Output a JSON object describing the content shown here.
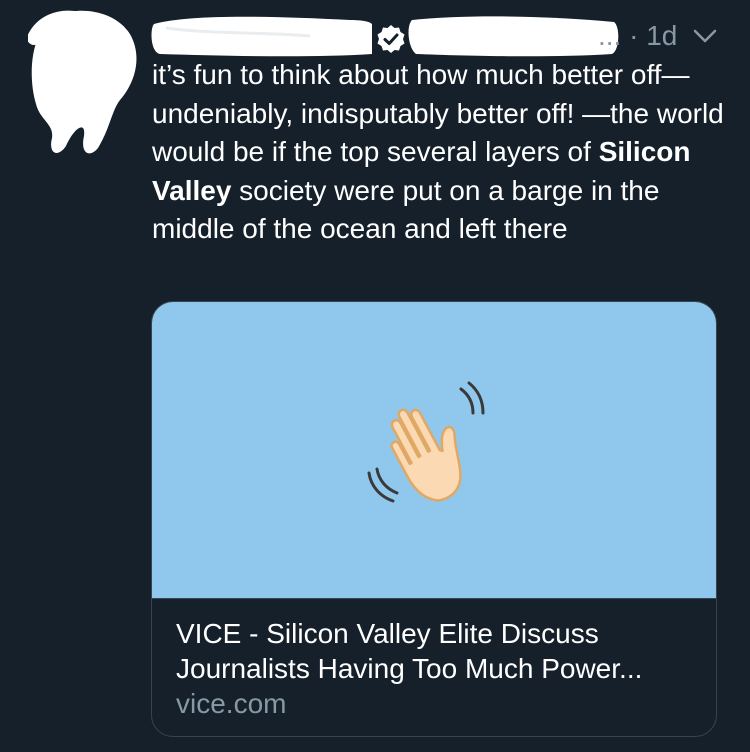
{
  "tweet": {
    "timestamp": "1d",
    "meta_prefix": "... · ",
    "text_before_bold": "it’s fun to think about how much better off—undeniably, indisputably better off! —the world would be if the top several layers of ",
    "text_bold": "Silicon Valley",
    "text_after_bold": " society were put on a barge in the middle of the ocean and left there"
  },
  "card": {
    "title": "VICE - Silicon Valley Elite Discuss Journalists Having Too Much Power...",
    "domain": "vice.com",
    "image_icon": "waving-hand-icon"
  },
  "colors": {
    "background": "#15202b",
    "card_image_bg": "#90c8ed",
    "text": "#ffffff",
    "secondary_text": "#8899a6",
    "border": "#38444d"
  }
}
